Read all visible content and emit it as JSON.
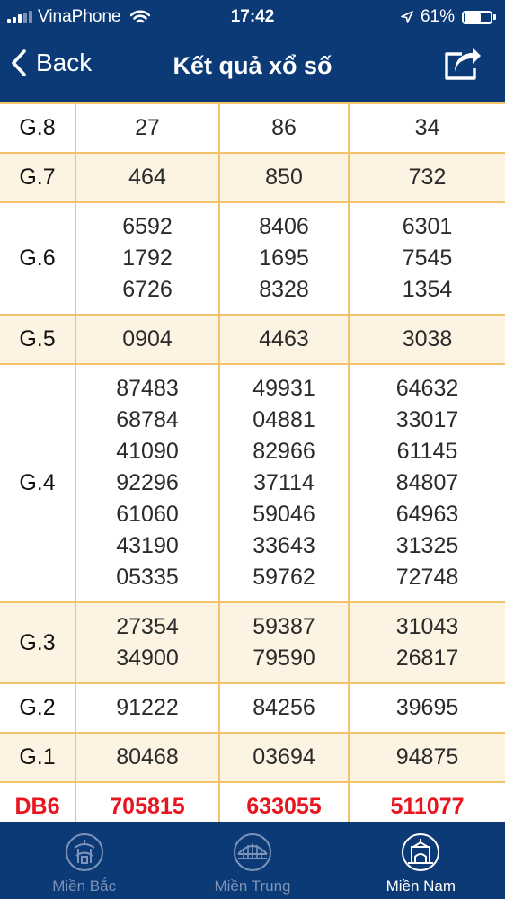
{
  "status_bar": {
    "carrier": "VinaPhone",
    "time": "17:42",
    "battery_percent": "61%",
    "battery_level": 0.61,
    "icons": [
      "signal-icon",
      "wifi-icon",
      "location-arrow-icon",
      "battery-icon"
    ]
  },
  "header": {
    "back_label": "Back",
    "title": "Kết quả xổ số",
    "share_icon": "share-icon"
  },
  "results": {
    "rows": [
      {
        "label": "G.8",
        "cols": [
          [
            "27"
          ],
          [
            "86"
          ],
          [
            "34"
          ]
        ]
      },
      {
        "label": "G.7",
        "cols": [
          [
            "464"
          ],
          [
            "850"
          ],
          [
            "732"
          ]
        ]
      },
      {
        "label": "G.6",
        "cols": [
          [
            "6592",
            "1792",
            "6726"
          ],
          [
            "8406",
            "1695",
            "8328"
          ],
          [
            "6301",
            "7545",
            "1354"
          ]
        ]
      },
      {
        "label": "G.5",
        "cols": [
          [
            "0904"
          ],
          [
            "4463"
          ],
          [
            "3038"
          ]
        ]
      },
      {
        "label": "G.4",
        "cols": [
          [
            "87483",
            "68784",
            "41090",
            "92296",
            "61060",
            "43190",
            "05335"
          ],
          [
            "49931",
            "04881",
            "82966",
            "37114",
            "59046",
            "33643",
            "59762"
          ],
          [
            "64632",
            "33017",
            "61145",
            "84807",
            "64963",
            "31325",
            "72748"
          ]
        ]
      },
      {
        "label": "G.3",
        "cols": [
          [
            "27354",
            "34900"
          ],
          [
            "59387",
            "79590"
          ],
          [
            "31043",
            "26817"
          ]
        ]
      },
      {
        "label": "G.2",
        "cols": [
          [
            "91222"
          ],
          [
            "84256"
          ],
          [
            "39695"
          ]
        ]
      },
      {
        "label": "G.1",
        "cols": [
          [
            "80468"
          ],
          [
            "03694"
          ],
          [
            "94875"
          ]
        ]
      },
      {
        "label": "DB6",
        "cols": [
          [
            "705815"
          ],
          [
            "633055"
          ],
          [
            "511077"
          ]
        ]
      }
    ]
  },
  "tabs": [
    {
      "label": "Miền Bắc",
      "icon": "pagoda-icon",
      "active": false
    },
    {
      "label": "Miền Trung",
      "icon": "bridge-icon",
      "active": false
    },
    {
      "label": "Miền Nam",
      "icon": "market-hall-icon",
      "active": true
    }
  ],
  "colors": {
    "header_bg": "#0b3a76",
    "grid_line": "#f2c36b",
    "alt_row_bg": "#fdf3e2",
    "special_prize": "#e8141e",
    "tab_inactive": "#7d93b8"
  }
}
